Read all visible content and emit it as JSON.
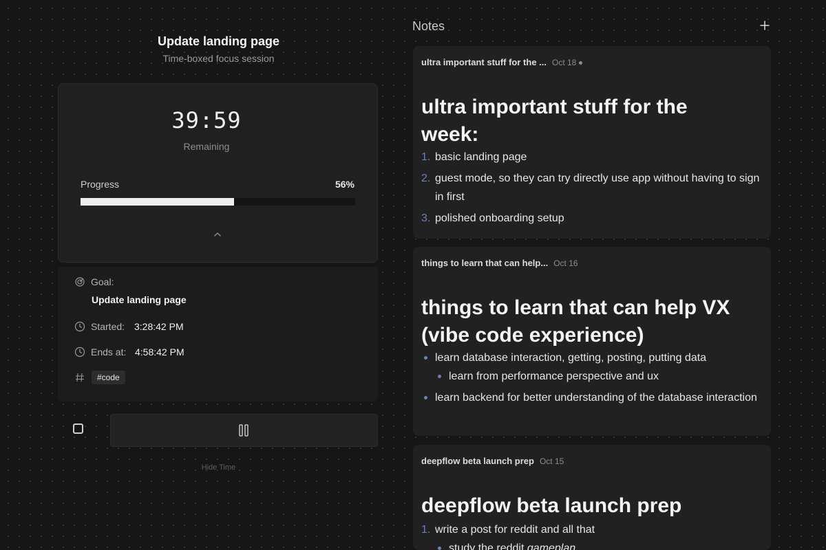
{
  "session": {
    "title": "Update landing page",
    "subtitle": "Time-boxed focus session"
  },
  "timer": {
    "time": "39:59",
    "remaining_label": "Remaining",
    "progress_label": "Progress",
    "progress_text": "56%",
    "progress_value": 0.56
  },
  "details": {
    "goal_label": "Goal:",
    "goal_value": "Update landing page",
    "started_label": "Started:",
    "started_value": "3:28:42 PM",
    "ends_label": "Ends at:",
    "ends_value": "4:58:42 PM",
    "tag_value": "#code"
  },
  "controls": {
    "hide_time_label": "Hide Time"
  },
  "notes_panel": {
    "heading": "Notes"
  },
  "notes": [
    {
      "header": "ultra important stuff for the ...",
      "date": "Oct 18",
      "title_line1": "ultra important stuff for the",
      "title_line2": "week:",
      "items": [
        {
          "num": "1.",
          "text": "basic landing page"
        },
        {
          "num": "2.",
          "text": "guest mode, so they can try directly use app without having to sign in first"
        },
        {
          "num": "3.",
          "text": "polished onboarding setup"
        }
      ]
    },
    {
      "header": "things to learn that can help...",
      "date": "Oct 16",
      "title_line1": "things to learn that can help VX",
      "title_line2": "(vibe code experience)",
      "items": [
        {
          "text": "learn database interaction, getting, posting, putting data"
        },
        {
          "text": "learn from performance perspective and ux"
        },
        {
          "text": "learn backend for better understanding of the database interaction"
        }
      ]
    },
    {
      "header": "deepflow beta launch prep",
      "date": "Oct 15",
      "title_line1": "deepflow beta launch prep",
      "items": [
        {
          "num": "1.",
          "text": "write a post for reddit and all that"
        },
        {
          "text_a": "study the reddit ",
          "text_b": "gameplan"
        }
      ]
    }
  ],
  "colors": {
    "background": "#161616",
    "card": "#202020",
    "list_marker": "#6a83b8",
    "progress_fill": "#eeeeee"
  },
  "icons": [
    "target-icon",
    "clock-icon",
    "hash-icon",
    "chevron-up-icon",
    "pause-icon",
    "plus-icon",
    "checkbox-icon"
  ]
}
